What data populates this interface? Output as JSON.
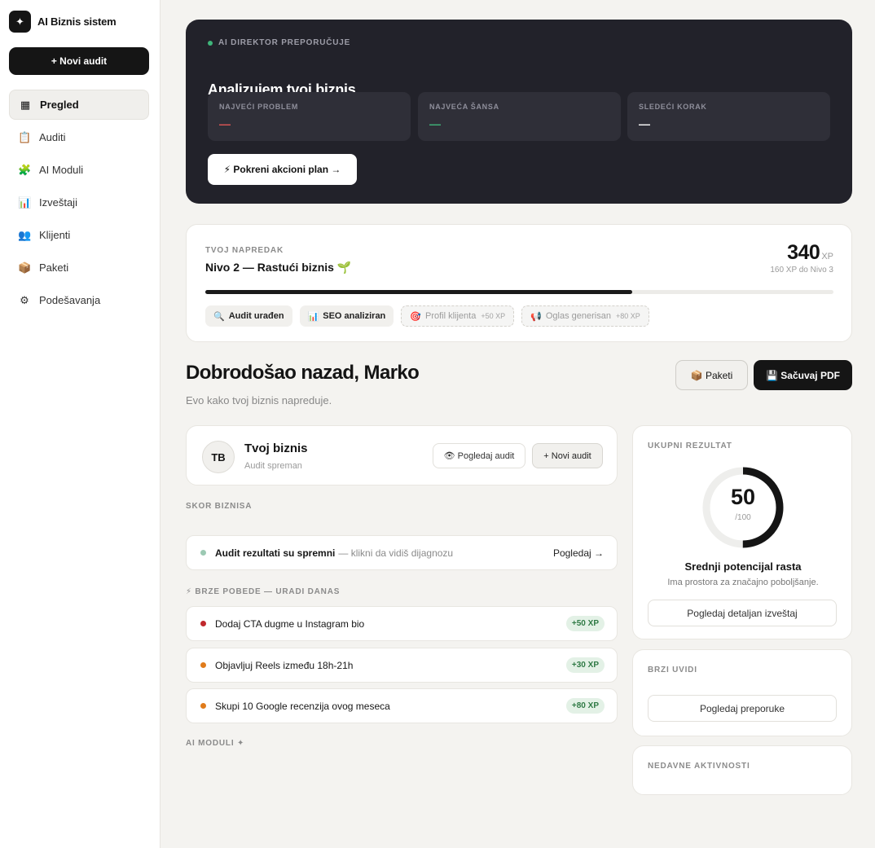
{
  "sidebar": {
    "brand": {
      "logo_glyph": "✦",
      "name": "AI Biznis sistem"
    },
    "new_audit_label": "+ Novi audit",
    "items": [
      {
        "label": "Pregled",
        "icon": "grid-icon",
        "glyph": "▦",
        "active": true
      },
      {
        "label": "Auditi",
        "icon": "clipboard-icon",
        "glyph": "📋"
      },
      {
        "label": "AI Moduli",
        "icon": "puzzle-icon",
        "glyph": "🧩"
      },
      {
        "label": "Izveštaji",
        "icon": "bar-chart-icon",
        "glyph": "📊"
      },
      {
        "label": "Klijenti",
        "icon": "users-icon",
        "glyph": "👥"
      },
      {
        "label": "Paketi",
        "icon": "package-icon",
        "glyph": "📦"
      },
      {
        "label": "Podešavanja",
        "icon": "gear-icon",
        "glyph": "⚙"
      }
    ]
  },
  "director": {
    "eyebrow": "AI DIREKTOR PREPORUČUJE",
    "title": "Analizujem tvoj biznis...",
    "boxes": [
      {
        "label": "NAJVEĆI PROBLEM",
        "value": "—",
        "color": "#e05656"
      },
      {
        "label": "NAJVEĆA ŠANSA",
        "value": "—",
        "color": "#3fb57a"
      },
      {
        "label": "SLEDEĆI KORAK",
        "value": "—",
        "color": "#ffffff"
      }
    ],
    "action_label": "⚡ Pokreni akcioni plan →"
  },
  "progress": {
    "eyebrow": "TVOJ NAPREDAK",
    "level": "Nivo 2 — Rastući biznis 🌱",
    "xp": "340",
    "xp_unit": "XP",
    "xp_sub": "160 XP do Nivo 3",
    "fill": 0.68,
    "badges": [
      {
        "glyph": "🔍",
        "label": "Audit urađen",
        "xp": "",
        "locked": false
      },
      {
        "glyph": "📊",
        "label": "SEO analiziran",
        "xp": "",
        "locked": false
      },
      {
        "glyph": "🎯",
        "label": "Profil klijenta",
        "xp": "+50 XP",
        "locked": true
      },
      {
        "glyph": "📢",
        "label": "Oglas generisan",
        "xp": "+80 XP",
        "locked": true
      }
    ]
  },
  "greeting": {
    "title": "Dobrodošao nazad, Marko",
    "subtitle": "Evo kako tvoj biznis napreduje.",
    "paketi_label": "📦 Paketi",
    "pdf_label": "💾 Sačuvaj PDF"
  },
  "business": {
    "initials": "TB",
    "name": "Tvoj biznis",
    "status": "Audit spreman",
    "view_label": "👁 Pogledaj audit",
    "new_label": "+ Novi audit"
  },
  "score_section": {
    "label": "SKOR BIZNISA",
    "row_text": "Audit rezultati su spremni",
    "row_muted": "— klikni da vidiš dijagnozu",
    "row_link": "Pogledaj →",
    "dot_color": "#9cc9b3"
  },
  "quick_wins": {
    "label": "⚡ BRZE POBEDE — URADI DANAS",
    "items": [
      {
        "text": "Dodaj CTA dugme u Instagram bio",
        "xp": "+50 XP",
        "color": "#c0282d"
      },
      {
        "text": "Objavljuj Reels između 18h-21h",
        "xp": "+30 XP",
        "color": "#e07b1a"
      },
      {
        "text": "Skupi 10 Google recenzija ovog meseca",
        "xp": "+80 XP",
        "color": "#e07b1a"
      }
    ]
  },
  "modules_label": "AI MODULI ✦",
  "score_card": {
    "eyebrow": "UKUPNI REZULTAT",
    "score": 50,
    "score_text": "50",
    "max": "/100",
    "title": "Srednji potencijal rasta",
    "desc": "Ima prostora za značajno poboljšanje.",
    "button": "Pogledaj detaljan izveštaj"
  },
  "insights": {
    "eyebrow": "BRZI UVIDI",
    "button": "Pogledaj preporuke"
  },
  "activity": {
    "eyebrow": "NEDAVNE AKTIVNOSTI"
  }
}
